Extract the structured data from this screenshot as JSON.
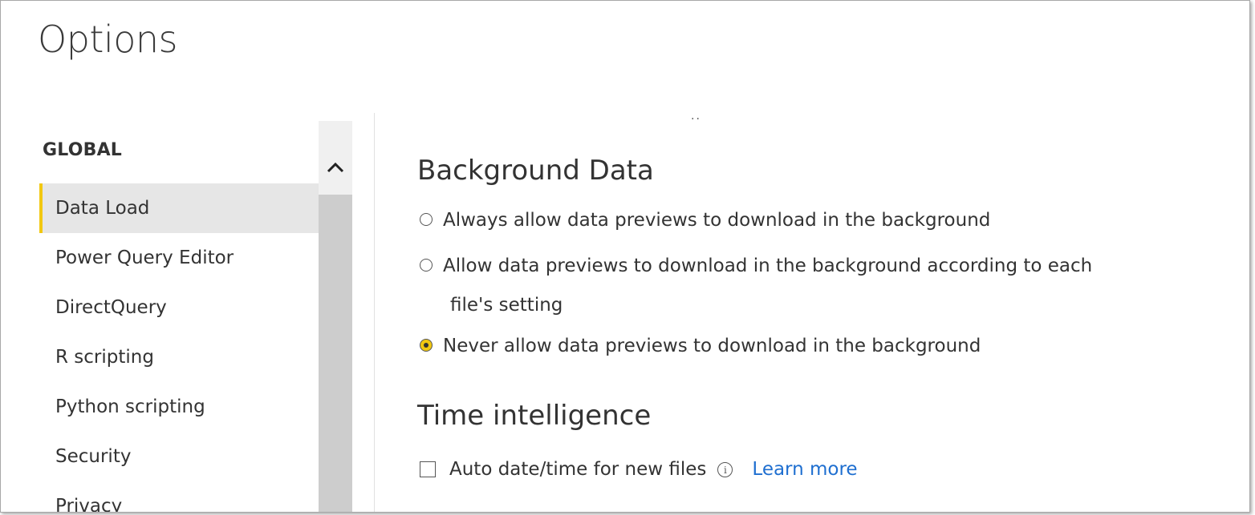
{
  "dialog": {
    "title": "Options"
  },
  "sidebar": {
    "heading": "GLOBAL",
    "items": [
      {
        "label": "Data Load",
        "selected": true
      },
      {
        "label": "Power Query Editor",
        "selected": false
      },
      {
        "label": "DirectQuery",
        "selected": false
      },
      {
        "label": "R scripting",
        "selected": false
      },
      {
        "label": "Python scripting",
        "selected": false
      },
      {
        "label": "Security",
        "selected": false
      },
      {
        "label": "Privacy",
        "selected": false
      }
    ],
    "scroll_up_icon": "chevron-up-icon"
  },
  "content": {
    "truncated_marker": "..",
    "background_data": {
      "title": "Background Data",
      "options": [
        {
          "label": "Always allow data previews to download in the background",
          "checked": false
        },
        {
          "label": "Allow data previews to download in the background according to each",
          "continuation": "file's setting",
          "checked": false
        },
        {
          "label": "Never allow data previews to download in the background",
          "checked": true
        }
      ]
    },
    "time_intelligence": {
      "title": "Time intelligence",
      "auto_datetime_label": "Auto date/time for new files",
      "auto_datetime_checked": false,
      "info_icon": "info-icon",
      "learn_more": "Learn more"
    }
  },
  "colors": {
    "accent": "#f2c811",
    "link": "#1f6fd0",
    "selected_bg": "#e6e6e6"
  }
}
